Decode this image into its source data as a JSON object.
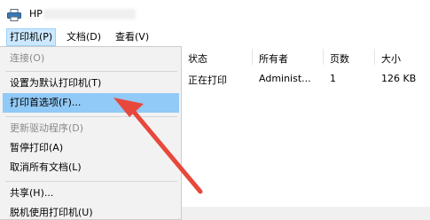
{
  "window": {
    "title": "HP"
  },
  "menubar": {
    "items": [
      {
        "label": "打印机(P)"
      },
      {
        "label": "文档(D)"
      },
      {
        "label": "查看(V)"
      }
    ]
  },
  "printer_menu": {
    "items": [
      {
        "label": "连接(O)",
        "enabled": false
      },
      {
        "label": "设置为默认打印机(T)",
        "enabled": true
      },
      {
        "label": "打印首选项(F)...",
        "enabled": true,
        "highlighted": true
      },
      {
        "label": "更新驱动程序(D)",
        "enabled": false
      },
      {
        "label": "暂停打印(A)",
        "enabled": true
      },
      {
        "label": "取消所有文档(L)",
        "enabled": true
      },
      {
        "label": "共享(H)...",
        "enabled": true
      },
      {
        "label": "脱机使用打印机(U)",
        "enabled": true
      }
    ]
  },
  "queue": {
    "columns": [
      "状态",
      "所有者",
      "页数",
      "大小"
    ],
    "rows": [
      {
        "status": "正在打印",
        "owner": "Administ...",
        "pages": "1",
        "size": "126 KB"
      }
    ]
  },
  "colors": {
    "menu_highlight": "#91c9f7",
    "menubar_active": "#cce8ff",
    "annotation_arrow": "#e8483c"
  },
  "annotation": {
    "icon": "red-arrow-icon"
  }
}
